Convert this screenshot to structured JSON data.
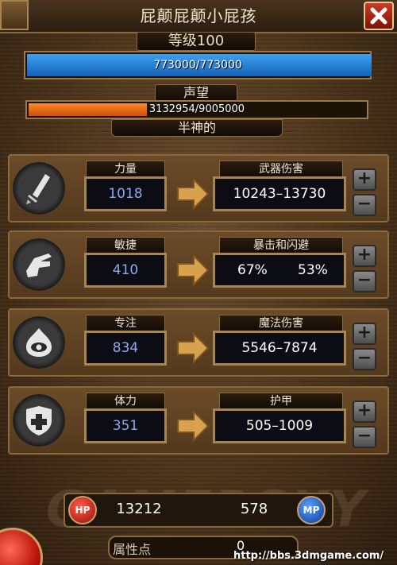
{
  "header": {
    "title": "屁颠屁颠小屁孩"
  },
  "level": {
    "label": "等级100",
    "hp_text": "773000/773000",
    "hp_fraction": 1.0
  },
  "reputation": {
    "label": "声望",
    "text": "3132954/9005000",
    "fraction": 0.348,
    "rank": "半神的"
  },
  "stats": [
    {
      "icon": "sword-icon",
      "name": "力量",
      "value": "1018",
      "result_label": "武器伤害",
      "result": "10243–13730"
    },
    {
      "icon": "hand-icon",
      "name": "敏捷",
      "value": "410",
      "result_label": "暴击和闪避",
      "result_a": "67%",
      "result_b": "53%"
    },
    {
      "icon": "eye-flame-icon",
      "name": "专注",
      "value": "834",
      "result_label": "魔法伤害",
      "result": "5546–7874"
    },
    {
      "icon": "shield-cross-icon",
      "name": "体力",
      "value": "351",
      "result_label": "护甲",
      "result": "505–1009"
    }
  ],
  "footer": {
    "hp_badge": "HP",
    "hp_value": "13212",
    "mp_badge": "MP",
    "mp_value": "578",
    "points_label": "属性点",
    "points_value": "0",
    "watermark": "GAMERSKY",
    "url": "http://bbs.3dmgame.com/"
  },
  "colors": {
    "hp_bar": "#1f7fd6",
    "rep_bar": "#f06a12",
    "stat_value": "#8fa8f0",
    "result_text": "#ffffff"
  }
}
